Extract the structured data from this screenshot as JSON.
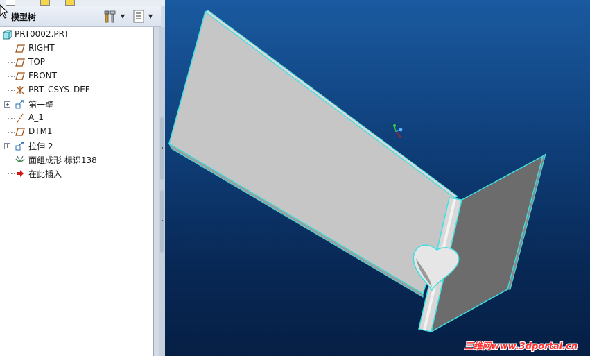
{
  "model_tree": {
    "title": "模型树",
    "items": [
      {
        "label": "PRT0002.PRT",
        "icon": "part-icon",
        "expandable": false
      },
      {
        "label": "RIGHT",
        "icon": "datum-plane-icon",
        "expandable": false
      },
      {
        "label": "TOP",
        "icon": "datum-plane-icon",
        "expandable": false
      },
      {
        "label": "FRONT",
        "icon": "datum-plane-icon",
        "expandable": false
      },
      {
        "label": "PRT_CSYS_DEF",
        "icon": "csys-icon",
        "expandable": false
      },
      {
        "label": "第一壁",
        "icon": "sheetmetal-wall-icon",
        "expandable": true
      },
      {
        "label": "A_1",
        "icon": "datum-axis-icon",
        "expandable": false
      },
      {
        "label": "DTM1",
        "icon": "datum-plane-icon",
        "expandable": false
      },
      {
        "label": "拉伸 2",
        "icon": "sheetmetal-wall-icon",
        "expandable": true
      },
      {
        "label": "面组成形 标识138",
        "icon": "form-icon",
        "expandable": false
      },
      {
        "label": "在此插入",
        "icon": "insert-arrow-icon",
        "expandable": false
      }
    ]
  },
  "watermark": "三维网www.3dportal.cn",
  "colors": {
    "edge_highlight": "#3de0e0",
    "viewport_top": "#1a5aa0",
    "viewport_bottom": "#061f45",
    "watermark": "#ff3333"
  }
}
